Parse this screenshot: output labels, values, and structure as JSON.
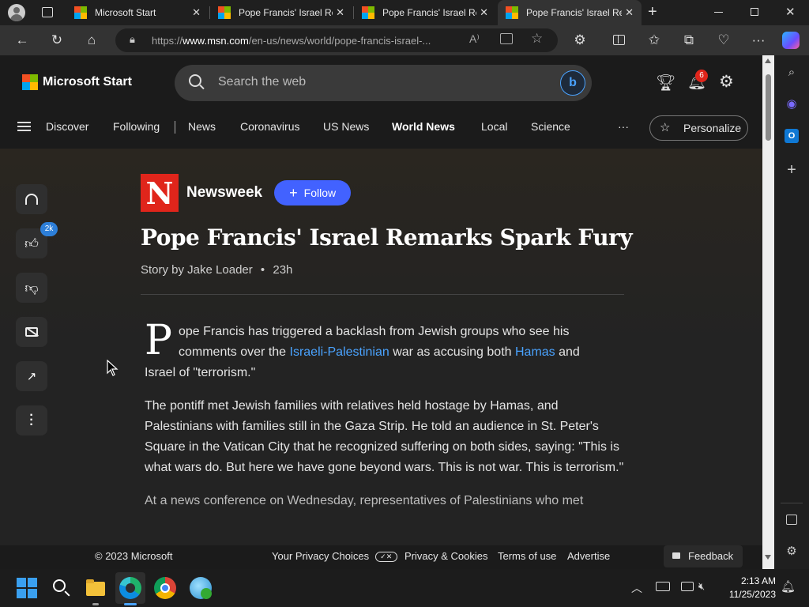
{
  "tabs": [
    {
      "title": "Microsoft Start"
    },
    {
      "title": "Pope Francis' Israel Re"
    },
    {
      "title": "Pope Francis' Israel Re"
    },
    {
      "title": "Pope Francis' Israel Re"
    }
  ],
  "address": {
    "scheme": "https://",
    "host": "www.msn.com",
    "path": "/en-us/news/world/pope-francis-israel-..."
  },
  "site": {
    "brand": "Microsoft Start",
    "search_placeholder": "Search the web",
    "notification_count": "6"
  },
  "nav": {
    "items": [
      "Discover",
      "Following",
      "News",
      "Coronavirus",
      "US News",
      "World News",
      "Local",
      "Science"
    ],
    "more": "···",
    "personalize": "Personalize"
  },
  "rail": {
    "like_count": "2k"
  },
  "article": {
    "publisher": "Newsweek",
    "publisher_logo": "N",
    "follow": "Follow",
    "headline": "Pope Francis' Israel Remarks Spark Fury",
    "byline": "Story by Jake Loader",
    "age": "23h",
    "p1_dropcap": "P",
    "p1_a": "ope Francis has triggered a backlash from Jewish groups who see his comments over the ",
    "p1_link1": "Israeli-Palestinian",
    "p1_b": " war as accusing both ",
    "p1_link2": "Hamas",
    "p1_c": " and Israel of \"terrorism.\"",
    "p2": "The pontiff met Jewish families with relatives held hostage by Hamas, and Palestinians with families still in the Gaza Strip. He told an audience in St. Peter's Square in the Vatican City that he recognized suffering on both sides, saying: \"This is what wars do. But here we have gone beyond wars. This is not war. This is terrorism.\"",
    "p3": "At a news conference on Wednesday, representatives of Palestinians who met"
  },
  "footer": {
    "copyright": "© 2023 Microsoft",
    "privacy_choices": "Your Privacy Choices",
    "privacy_cookies": "Privacy & Cookies",
    "terms": "Terms of use",
    "advertise": "Advertise",
    "feedback": "Feedback"
  },
  "clock": {
    "time": "2:13 AM",
    "date": "11/25/2023"
  },
  "colors": {
    "accent": "#4262ff",
    "newsweek_red": "#e0251b",
    "link": "#4aa3ff"
  }
}
